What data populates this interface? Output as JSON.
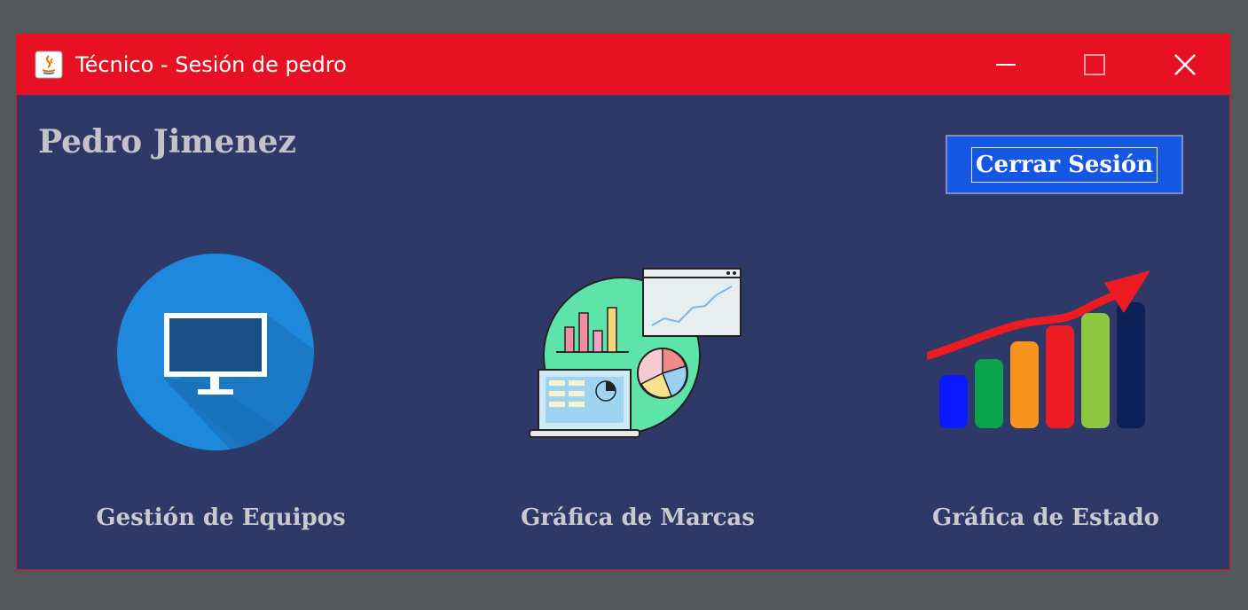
{
  "window": {
    "title": "Técnico - Sesión de pedro",
    "colors": {
      "titlebar": "#e81123",
      "background": "#2e3967",
      "accent_button": "#1556e3"
    }
  },
  "header": {
    "user_name": "Pedro Jimenez",
    "logout_label": "Cerrar Sesión"
  },
  "tiles": [
    {
      "label": "Gestión de Equipos",
      "icon": "monitor-icon"
    },
    {
      "label": "Gráfica de Marcas",
      "icon": "charts-dashboard-icon"
    },
    {
      "label": "Gráfica de Estado",
      "icon": "growth-bar-chart-icon"
    }
  ]
}
